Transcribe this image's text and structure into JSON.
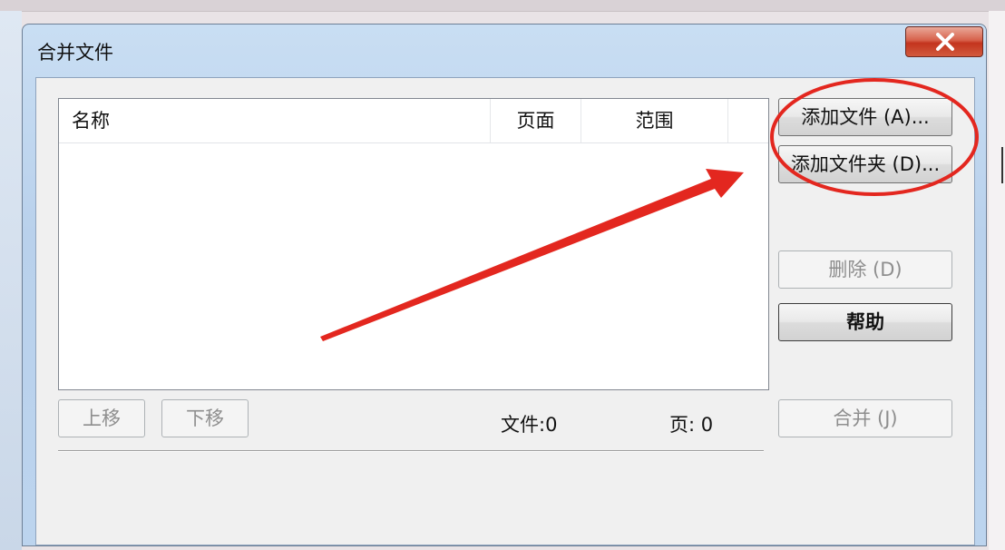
{
  "window": {
    "title": "合并文件"
  },
  "list": {
    "columns": [
      "名称",
      "页面",
      "范围"
    ],
    "rows": []
  },
  "buttons": {
    "add_file": "添加文件 (A)...",
    "add_folder": "添加文件夹 (D)...",
    "delete": "删除 (D)",
    "help": "帮助",
    "merge": "合并 (J)",
    "move_up": "上移",
    "move_down": "下移"
  },
  "status": {
    "files": "文件:0",
    "pages": "页: 0"
  },
  "colors": {
    "annotation": "#e3271f",
    "close_button": "#c9412b"
  },
  "icons": {
    "close": "close-icon"
  }
}
